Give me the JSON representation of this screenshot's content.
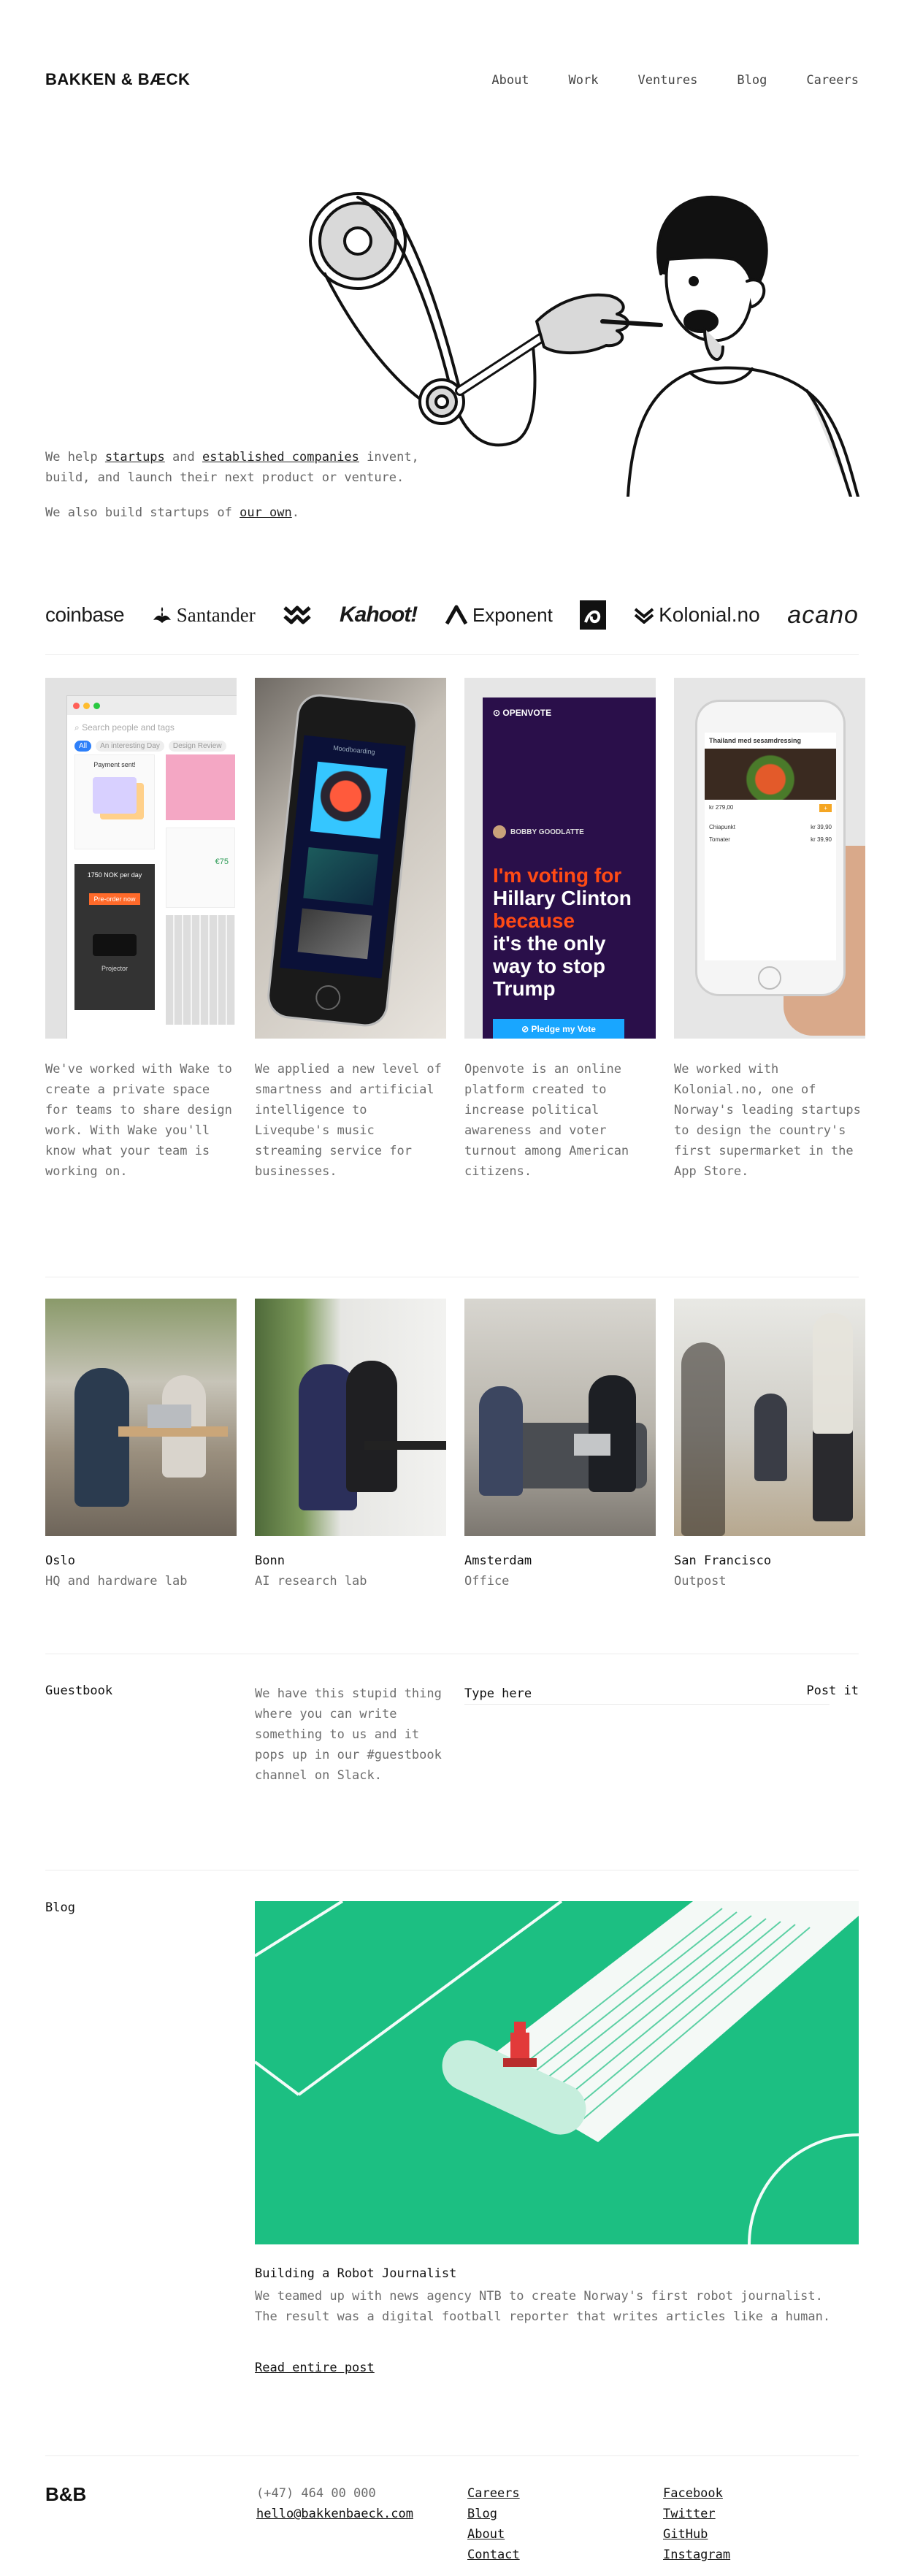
{
  "header": {
    "logo": "BAKKEN & BÆCK",
    "nav": [
      "About",
      "Work",
      "Ventures",
      "Blog",
      "Careers"
    ]
  },
  "intro": {
    "line1_prefix": "We help ",
    "link_startups": "startups",
    "line1_and": " and ",
    "link_companies": "established companies",
    "line1_suffix": " invent, build, and launch their next product or venture.",
    "line2_prefix": "We also build startups of ",
    "link_own": "our own",
    "line2_suffix": "."
  },
  "clients": [
    "coinbase",
    "Santander",
    "Kahoot!",
    "Exponent",
    "Kolonial.no",
    "acano"
  ],
  "work": [
    {
      "text": "We've worked with Wake to create a private space for teams to share design work. With Wake you'll know what your team is working on.",
      "mock": {
        "search_placeholder": "Search people and tags",
        "tabs": [
          "All",
          "An interesting Day",
          "Design Review"
        ],
        "payment_card": "Payment sent!",
        "price_label": "€75",
        "product": "Projector",
        "order_label": "1750 NOK per day",
        "cta": "Pre-order now"
      }
    },
    {
      "text": "We applied a new level of smartness and artificial intelligence to Liveqube's music streaming service for businesses.",
      "mock": {
        "top_label": "Moodboarding"
      }
    },
    {
      "text": "Openvote is an online platform created to increase political awareness and voter turnout among American citizens.",
      "mock": {
        "brand": "OPENVOTE",
        "user": "BOBBY GOODLATTE",
        "line_a": "I'm voting for",
        "line_b": "Hillary Clinton",
        "line_c": "because",
        "line_d": "it's the only way to stop Trump",
        "cta": "Pledge my Vote"
      }
    },
    {
      "text": "We worked with Kolonial.no, one of Norway's leading startups to design the country's first supermarket in the App Store.",
      "mock": {
        "title": "Thailand med sesamdressing",
        "price": "kr 279,00",
        "items": [
          "Chiapunkt",
          "Tomater"
        ],
        "item_prices": [
          "kr 39,90",
          "kr 39,90"
        ]
      }
    }
  ],
  "offices": [
    {
      "city": "Oslo",
      "role": "HQ and hardware lab"
    },
    {
      "city": "Bonn",
      "role": "AI research lab"
    },
    {
      "city": "Amsterdam",
      "role": "Office"
    },
    {
      "city": "San Francisco",
      "role": "Outpost"
    }
  ],
  "guestbook": {
    "label": "Guestbook",
    "description": "We have this stupid thing where you can write something to us and it pops up in our #guestbook channel on Slack.",
    "placeholder": "Type here",
    "post": "Post it"
  },
  "blog": {
    "label": "Blog",
    "title": "Building a Robot Journalist",
    "excerpt": "We teamed up with news agency NTB to create Norway's first robot journalist. The result was a digital football reporter that writes articles like a human.",
    "link": "Read entire post"
  },
  "footer": {
    "logo": "B&B",
    "phone": "(+47) 464 00 000",
    "email": "hello@bakkenbaeck.com",
    "site_links": [
      "Careers",
      "Blog",
      "About",
      "Contact"
    ],
    "social_links": [
      "Facebook",
      "Twitter",
      "GitHub",
      "Instagram"
    ]
  },
  "colors": {
    "openvote_bg": "#2a0f4a",
    "openvote_accent": "#ff4a14",
    "blog_green": "#1cbf82"
  }
}
